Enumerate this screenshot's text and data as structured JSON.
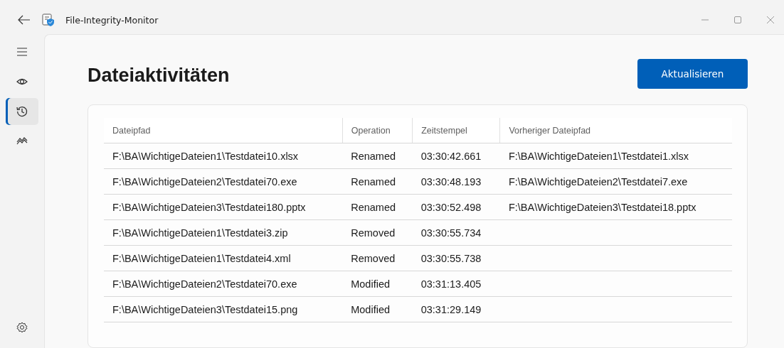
{
  "window": {
    "title": "File-Integrity-Monitor"
  },
  "sidebar": {
    "items": [
      {
        "kind": "eye",
        "selected": false
      },
      {
        "kind": "history",
        "selected": true
      },
      {
        "kind": "chart",
        "selected": false
      }
    ]
  },
  "page": {
    "title": "Dateiaktivitäten",
    "refresh_button": "Aktualisieren"
  },
  "table": {
    "columns": [
      "Dateipfad",
      "Operation",
      "Zeitstempel",
      "Vorheriger Dateipfad"
    ],
    "rows": [
      [
        "F:\\BA\\WichtigeDateien1\\Testdatei10.xlsx",
        "Renamed",
        "03:30:42.661",
        "F:\\BA\\WichtigeDateien1\\Testdatei1.xlsx"
      ],
      [
        "F:\\BA\\WichtigeDateien2\\Testdatei70.exe",
        "Renamed",
        "03:30:48.193",
        "F:\\BA\\WichtigeDateien2\\Testdatei7.exe"
      ],
      [
        "F:\\BA\\WichtigeDateien3\\Testdatei180.pptx",
        "Renamed",
        "03:30:52.498",
        "F:\\BA\\WichtigeDateien3\\Testdatei18.pptx"
      ],
      [
        "F:\\BA\\WichtigeDateien1\\Testdatei3.zip",
        "Removed",
        "03:30:55.734",
        ""
      ],
      [
        "F:\\BA\\WichtigeDateien1\\Testdatei4.xml",
        "Removed",
        "03:30:55.738",
        ""
      ],
      [
        "F:\\BA\\WichtigeDateien2\\Testdatei70.exe",
        "Modified",
        "03:31:13.405",
        ""
      ],
      [
        "F:\\BA\\WichtigeDateien3\\Testdatei15.png",
        "Modified",
        "03:31:29.149",
        ""
      ]
    ]
  }
}
